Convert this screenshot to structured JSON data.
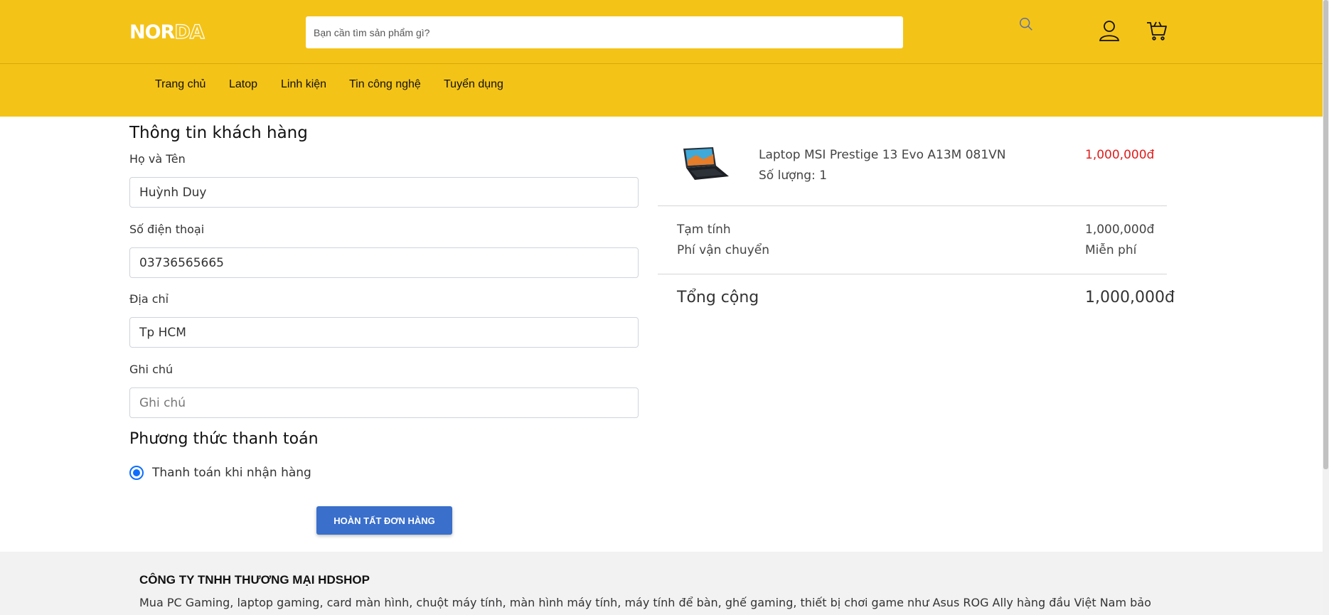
{
  "header": {
    "logo_solid": "NOR",
    "logo_outline": "DA",
    "search_placeholder": "Bạn cần tìm sản phẩm gì?",
    "icons": [
      "search-icon",
      "user-icon",
      "cart-icon"
    ]
  },
  "nav": {
    "items": [
      "Trang chủ",
      "Latop",
      "Linh kiện",
      "Tin công nghệ",
      "Tuyển dụng"
    ]
  },
  "customer": {
    "title": "Thông tin khách hàng",
    "name_label": "Họ và Tên",
    "name_value": "Huỳnh Duy",
    "phone_label": "Số điện thoại",
    "phone_value": "03736565665",
    "address_label": "Địa chỉ",
    "address_value": "Tp HCM",
    "note_label": "Ghi chú",
    "note_placeholder": "Ghi chú",
    "note_value": ""
  },
  "payment": {
    "title": "Phương thức thanh toán",
    "option": "Thanh toán khi nhận hàng",
    "selected": true
  },
  "submit_label": "HOÀN TẤT ĐƠN HÀNG",
  "order": {
    "product_name": "Laptop MSI Prestige 13 Evo A13M 081VN",
    "quantity_text": "Số lượng: 1",
    "product_price": "1,000,000đ",
    "subtotal_label": "Tạm tính",
    "subtotal_value": "1,000,000đ",
    "shipping_label": "Phí vận chuyển",
    "shipping_value": "Miễn phí",
    "total_label": "Tổng cộng",
    "total_value": "1,000,000đ"
  },
  "footer": {
    "company": "CÔNG TY TNHH THƯƠNG MẠI HDSHOP",
    "description": "Mua PC Gaming, laptop gaming, card màn hình, chuột máy tính, màn hình máy tính, máy tính để bàn, ghế gaming, thiết bị chơi game như Asus ROG Ally hàng đầu Việt Nam bảo hành"
  },
  "colors": {
    "brand_yellow": "#f4c317",
    "button_blue": "#3a6fcb",
    "price_red": "#e01b1b",
    "radio_blue": "#0d6efd"
  }
}
